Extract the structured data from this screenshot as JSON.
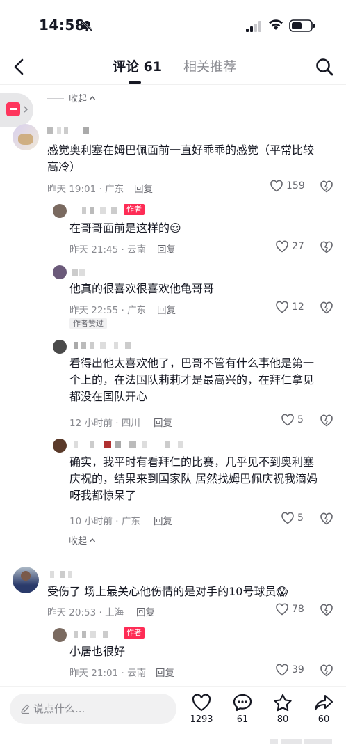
{
  "status_bar": {
    "time": "14:58"
  },
  "header": {
    "tabs": [
      {
        "label": "评论 61",
        "active": true
      },
      {
        "label": "相关推荐",
        "active": false
      }
    ]
  },
  "collapse_label": "收起",
  "comments": [
    {
      "text_lines": [
        "感觉奥利塞在姆巴佩面前一直好乖乖的感觉（平常比较",
        "高冷）"
      ],
      "time": "昨天 19:01",
      "location": "广东",
      "reply_label": "回复",
      "likes": "159",
      "replies": [
        {
          "text": "在哥哥面前是这样的😌",
          "is_author": true,
          "author_tag": "作者",
          "time": "昨天 21:45",
          "location": "云南",
          "reply_label": "回复",
          "likes": "27"
        },
        {
          "text": "他真的很喜欢很喜欢他龟哥哥",
          "is_author": false,
          "time": "昨天 22:55",
          "location": "广东",
          "reply_label": "回复",
          "likes": "12",
          "badge": "作者赞过"
        },
        {
          "text_lines": [
            "看得出他太喜欢他了，巴哥不管有什么事他是第一",
            "个上的，在法国队莉莉才是最高兴的，在拜仁拿见",
            "都没在国队开心"
          ],
          "time": "12 小时前",
          "location": "四川",
          "reply_label": "回复",
          "likes": "5"
        },
        {
          "text_lines": [
            "确实，我平时有看拜仁的比赛，几乎见不到奥利塞",
            "庆祝的，结果来到国家队 居然找姆巴佩庆祝我滴妈",
            "呀我都惊呆了"
          ],
          "time": "10 小时前",
          "location": "广东",
          "reply_label": "回复",
          "likes": "5"
        }
      ]
    },
    {
      "text": "受伤了  场上最关心他伤情的是对手的10号球员😱",
      "time": "昨天 20:53",
      "location": "上海",
      "reply_label": "回复",
      "likes": "78",
      "replies": [
        {
          "text": "小居也很好",
          "is_author": true,
          "author_tag": "作者",
          "time": "昨天 21:01",
          "location": "云南",
          "reply_label": "回复",
          "likes": "39"
        }
      ]
    }
  ],
  "bottom_bar": {
    "placeholder": "说点什么...",
    "likes": "1293",
    "comments": "61",
    "favorites": "80",
    "shares": "60"
  },
  "colors": {
    "accent": "#fe2c55",
    "text": "#161823",
    "muted": "#8a8b91"
  }
}
